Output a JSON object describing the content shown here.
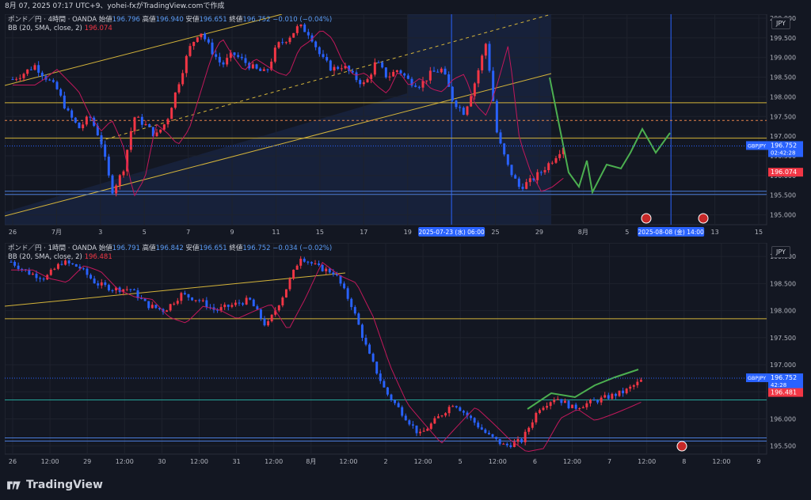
{
  "topbar": {
    "text": "8月 07, 2025 07:17 UTC+9、yohei-fxがTradingView.comで作成"
  },
  "footer": {
    "brand": "TradingView"
  },
  "colors": {
    "bg": "#131722",
    "grid": "#1e222d",
    "up": "#f23645",
    "down": "#2962ff",
    "bb": "#c2185b",
    "yellow": "#d4b43a",
    "blueLine": "#4a7bd8",
    "orangeDash": "#e6844a",
    "green": "#4caf50",
    "tealLine": "#26a69a",
    "shade": "#1b2a4e"
  },
  "panel1": {
    "header": {
      "symbol": "ポンド／円 · 4時間 · OANDA",
      "o_label": "始値",
      "o": "196.796",
      "h_label": "高値",
      "h": "196.940",
      "l_label": "安値",
      "l": "196.651",
      "c_label": "終値",
      "c": "196.752",
      "chg": "−0.010 (−0.04%)",
      "bb_label": "BB (20, SMA, close, 2)",
      "bb_value": "196.074"
    },
    "pair_button": "JPY",
    "price_tag": {
      "name": "GBPJPY",
      "price": "196.752",
      "timer": "02:42:28"
    },
    "bb_tag": "196.074",
    "x_labels": [
      "26",
      "7月",
      "3",
      "5",
      "7",
      "9",
      "11",
      "15",
      "17",
      "19",
      "2025-07-23 (水)  06:00",
      "25",
      "29",
      "8月",
      "5",
      "2025-08-08 (金)  14:00",
      "13",
      "15"
    ],
    "y_labels": [
      "200.000",
      "199.500",
      "199.000",
      "198.500",
      "198.000",
      "197.500",
      "197.000",
      "196.500",
      "196.000",
      "195.500",
      "195.000"
    ]
  },
  "panel2": {
    "header": {
      "symbol": "ポンド／円 · 1時間 · OANDA",
      "o_label": "始値",
      "o": "196.791",
      "h_label": "高値",
      "h": "196.842",
      "l_label": "安値",
      "l": "196.651",
      "c_label": "終値",
      "c": "196.752",
      "chg": "−0.034 (−0.02%)",
      "bb_label": "BB (20, SMA, close, 2)",
      "bb_value": "196.481"
    },
    "pair_button": "JPY",
    "price_tag": {
      "name": "GBPJPY",
      "price": "196.752",
      "timer": "42:28"
    },
    "bb_tag": "196.481",
    "x_labels": [
      "26",
      "12:00",
      "29",
      "12:00",
      "30",
      "12:00",
      "31",
      "12:00",
      "8月",
      "12:00",
      "2",
      "12:00",
      "5",
      "12:00",
      "6",
      "12:00",
      "7",
      "12:00",
      "8",
      "12:00",
      "9"
    ],
    "y_labels": [
      "199.000",
      "198.500",
      "198.000",
      "197.500",
      "197.000",
      "196.500",
      "196.000",
      "195.500"
    ]
  },
  "chart_data": [
    {
      "type": "candlestick",
      "title": "ポンド／円 · 4時間 · OANDA",
      "ylim": [
        194.75,
        200.1
      ],
      "x_ticks": [
        "26",
        "7月",
        "3",
        "5",
        "7",
        "9",
        "11",
        "15",
        "17",
        "19",
        "23",
        "25",
        "29",
        "8月",
        "5",
        "8",
        "13",
        "15"
      ],
      "close_path": [
        198.45,
        198.6,
        198.8,
        198.5,
        198.2,
        197.6,
        197.2,
        197.5,
        196.9,
        195.6,
        196.1,
        197.5,
        197.3,
        197.0,
        197.4,
        198.3,
        199.2,
        199.7,
        199.2,
        198.8,
        199.1,
        198.9,
        198.7,
        198.6,
        199.3,
        199.5,
        199.8,
        199.6,
        199.0,
        198.7,
        198.8,
        198.5,
        198.3,
        198.9,
        198.5,
        198.7,
        198.4,
        198.3,
        198.6,
        198.7,
        197.9,
        197.6,
        198.4,
        199.4,
        197.0,
        196.2,
        195.7,
        195.85,
        196.1,
        196.4,
        196.75
      ],
      "bb_value": 196.074,
      "levels": [
        197.85,
        196.95,
        195.6
      ],
      "orange_dashed": 197.4,
      "last": 196.752
    },
    {
      "type": "candlestick",
      "title": "ポンド／円 · 1時間 · OANDA",
      "ylim": [
        195.35,
        199.25
      ],
      "x_ticks": [
        "26",
        "12:00",
        "29",
        "12:00",
        "30",
        "12:00",
        "31",
        "12:00",
        "8月",
        "12:00",
        "2",
        "12:00",
        "5",
        "12:00",
        "6",
        "12:00",
        "7",
        "12:00",
        "8",
        "12:00",
        "9"
      ],
      "close_path": [
        198.9,
        198.7,
        198.6,
        198.9,
        198.8,
        198.5,
        198.4,
        198.4,
        198.1,
        198.0,
        198.3,
        198.2,
        198.0,
        198.1,
        198.2,
        197.7,
        198.3,
        199.0,
        198.8,
        198.7,
        198.1,
        197.2,
        196.5,
        196.1,
        195.7,
        196.0,
        196.3,
        196.0,
        195.7,
        195.5,
        195.6,
        196.2,
        196.4,
        196.2,
        196.3,
        196.4,
        196.5,
        196.7
      ],
      "bb_value": 196.481,
      "levels": [
        197.85,
        196.35,
        195.65
      ],
      "last": 196.752
    }
  ]
}
